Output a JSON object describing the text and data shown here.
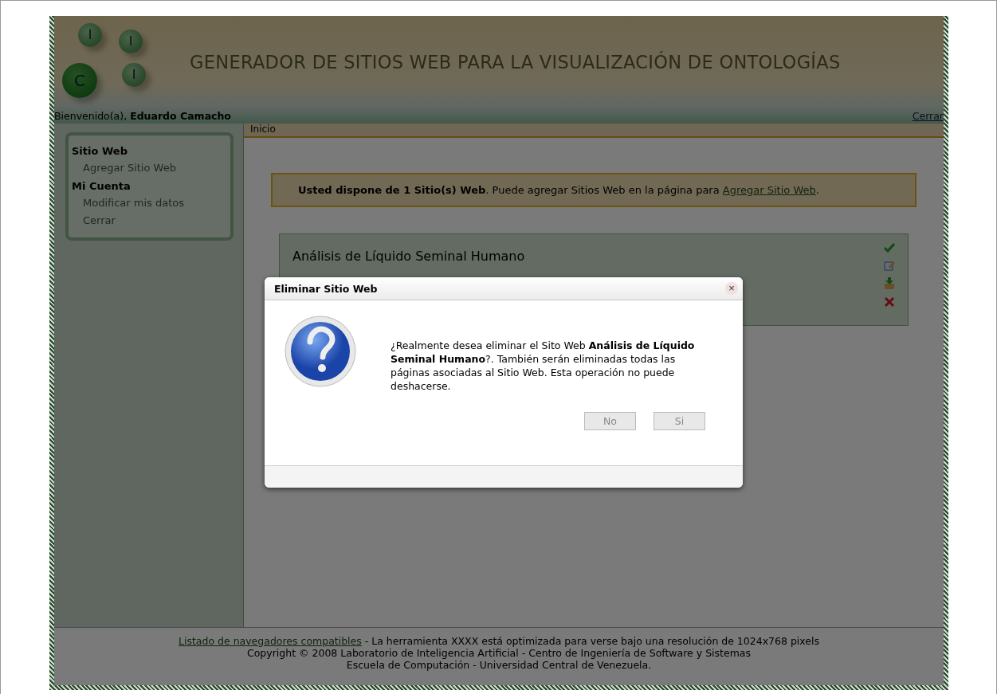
{
  "header": {
    "title": "GENERADOR DE SITIOS WEB PARA LA VISUALIZACIÓN DE ONTOLOGÍAS",
    "logo_letters": [
      "I",
      "I",
      "C",
      "I"
    ]
  },
  "user_bar": {
    "greeting": "Bienvenido(a),",
    "user": "Eduardo Camacho",
    "logout": "Cerrar"
  },
  "sidebar": {
    "sections": [
      {
        "title": "Sitio Web",
        "items": [
          "Agregar Sitio Web"
        ]
      },
      {
        "title": "Mi Cuenta",
        "items": [
          "Modificar mis datos",
          "Cerrar"
        ]
      }
    ]
  },
  "breadcrumb": "Inicio",
  "notice": {
    "text": "**Usted dispone de 1 Sitio(s) Web**. Puede agregar Sitios Web en la página para ",
    "link": "Agregar Sitio Web",
    "after": "."
  },
  "site_card": {
    "title": "Análisis de Líquido Seminal Humano"
  },
  "dialog": {
    "title": "Eliminar Sitio Web",
    "close": "×",
    "message": "¿Realmente desea eliminar el Sito Web **Análisis de Líquido Seminal Humano**?. También serán eliminadas todas las páginas asociadas al Sitio Web. Esta operación no puede deshacerse.",
    "buttons": [
      {
        "label": "No",
        "disabled": true
      },
      {
        "label": "Si",
        "disabled": true
      }
    ]
  },
  "footer": {
    "link": "Listado de navegadores compatibles",
    "line1": " - La herramienta XXXX está optimizada para verse bajo una resolución de 1024x768 pixels",
    "lines": [
      "Copyright © 2008 Laboratorio de Inteligencia Artificial - Centro de Ingeniería de Software y Sistemas",
      "Escuela de Computación - Universidad Central de Venezuela."
    ]
  }
}
